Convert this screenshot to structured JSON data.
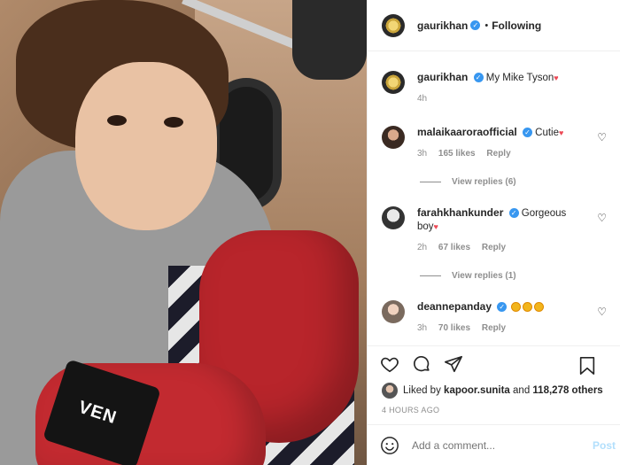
{
  "header": {
    "username": "gaurikhan",
    "separator": "•",
    "follow_status": "Following"
  },
  "caption": {
    "username": "gaurikhan",
    "text": "My Mike Tyson",
    "time": "4h"
  },
  "comments": [
    {
      "username": "malaikaaroraofficial",
      "text": "Cutie",
      "time": "3h",
      "likes": "165 likes",
      "reply": "Reply",
      "view_replies": "View replies (6)"
    },
    {
      "username": "farahkhankunder",
      "text": "Gorgeous boy",
      "time": "2h",
      "likes": "67 likes",
      "reply": "Reply",
      "view_replies": "View replies (1)"
    },
    {
      "username": "deannepanday",
      "text": "",
      "time": "3h",
      "likes": "70 likes",
      "reply": "Reply"
    }
  ],
  "likes": {
    "prefix": "Liked by",
    "user": "kapoor.sunita",
    "conj": "and",
    "others": "118,278 others"
  },
  "timestamp": "4 HOURS AGO",
  "composer": {
    "placeholder": "Add a comment...",
    "post_label": "Post"
  },
  "photo": {
    "brand_text": "VEN"
  },
  "colors": {
    "verified": "#3897f0",
    "link_disabled": "#b2dffc",
    "heart": "#ed4956"
  }
}
